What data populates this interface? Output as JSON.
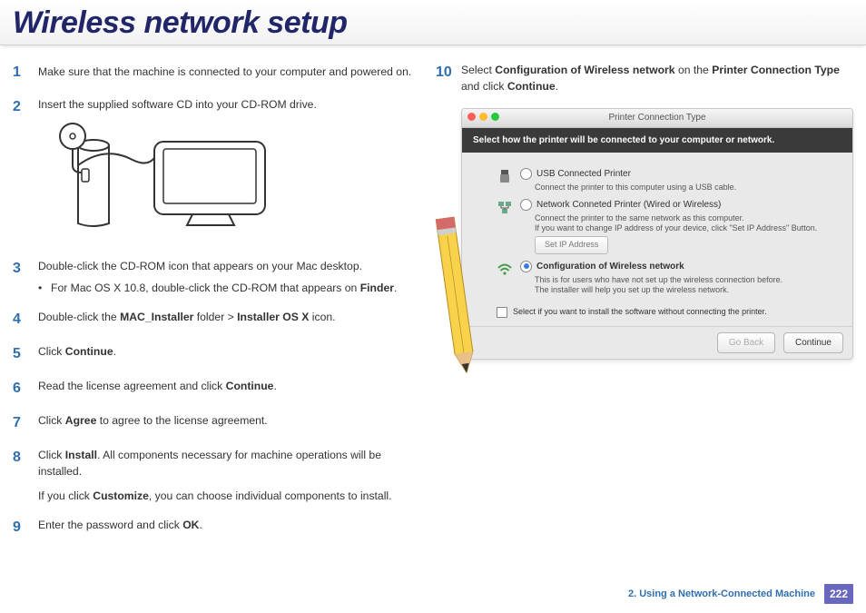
{
  "title": "Wireless network setup",
  "left_steps": [
    {
      "num": "1",
      "paras": [
        "Make sure that the machine is connected to your computer and powered on."
      ]
    },
    {
      "num": "2",
      "paras": [
        "Insert the supplied software CD into your CD-ROM drive."
      ],
      "illustration": true
    },
    {
      "num": "3",
      "paras": [
        "Double-click the CD-ROM icon that appears on your Mac desktop."
      ],
      "bullets": [
        {
          "pre": "For Mac OS X 10.8, double-click the CD-ROM that appears on ",
          "b": "Finder",
          "post": "."
        }
      ]
    },
    {
      "num": "4",
      "rich": [
        {
          "t": "Double-click the "
        },
        {
          "b": "MAC_Installer"
        },
        {
          "t": " folder > "
        },
        {
          "b": "Installer OS X"
        },
        {
          "t": " icon."
        }
      ]
    },
    {
      "num": "5",
      "rich": [
        {
          "t": "Click "
        },
        {
          "b": "Continue"
        },
        {
          "t": "."
        }
      ]
    },
    {
      "num": "6",
      "rich": [
        {
          "t": "Read the license agreement and click "
        },
        {
          "b": "Continue"
        },
        {
          "t": "."
        }
      ]
    },
    {
      "num": "7",
      "rich": [
        {
          "t": "Click "
        },
        {
          "b": "Agree"
        },
        {
          "t": " to agree to the license agreement."
        }
      ]
    },
    {
      "num": "8",
      "rich": [
        {
          "t": "Click "
        },
        {
          "b": "Install"
        },
        {
          "t": ". All components necessary for machine operations will be installed."
        }
      ],
      "extra_rich": [
        {
          "t": "If you click "
        },
        {
          "b": "Customize"
        },
        {
          "t": ", you can choose individual components to install."
        }
      ]
    },
    {
      "num": "9",
      "rich": [
        {
          "t": "Enter the password and click "
        },
        {
          "b": "OK"
        },
        {
          "t": "."
        }
      ]
    }
  ],
  "right_step": {
    "num": "10",
    "rich": [
      {
        "t": "Select "
      },
      {
        "b": "Configuration of Wireless network"
      },
      {
        "t": "  on the "
      },
      {
        "b": "Printer Connection Type"
      },
      {
        "t": " and click "
      },
      {
        "b": "Continue"
      },
      {
        "t": "."
      }
    ]
  },
  "dialog": {
    "window_title": "Printer Connection Type",
    "heading": "Select how the printer will be connected to your computer or network.",
    "options": [
      {
        "id": "usb",
        "label": "USB Connected Printer",
        "desc": "Connect the printer to this computer using a USB cable.",
        "selected": false
      },
      {
        "id": "net",
        "label": "Network Conneted Printer (Wired or Wireless)",
        "desc": "Connect the printer to the same network as this computer.\nIf you want to change IP address of your device, click \"Set IP Address\" Button.",
        "selected": false,
        "setip": "Set IP Address"
      },
      {
        "id": "wifi",
        "label": "Configuration of Wireless network",
        "desc": "This is for users who have not set up the wireless connection before.\nThe installer will help you set up the wireless network.",
        "selected": true
      }
    ],
    "checkbox_label": "Select if you want to install the software without connecting the printer.",
    "buttons": {
      "back": "Go Back",
      "cont": "Continue"
    }
  },
  "footer": {
    "chapter": "2.  Using a Network-Connected Machine",
    "page": "222"
  }
}
